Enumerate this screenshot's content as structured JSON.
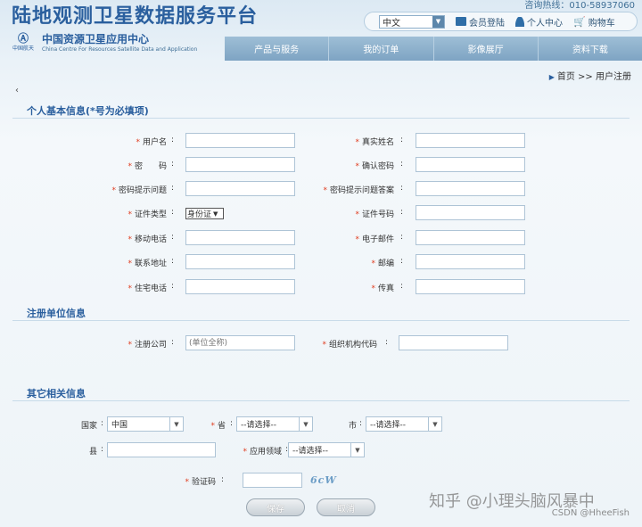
{
  "header": {
    "hotline": "咨询热线：010-58937060",
    "site_title": "陆地观测卫星数据服务平台",
    "org_logo_text": "中国航天",
    "org_name": "中国资源卫星应用中心",
    "org_name_en": "China Centre For Resources Satellite Data and Application",
    "language": "中文",
    "tools": {
      "login": "会员登陆",
      "user_center": "个人中心",
      "cart": "购物车"
    },
    "nav": [
      "产品与服务",
      "我的订单",
      "影像展厅",
      "资料下载"
    ]
  },
  "breadcrumb": {
    "home": "首页",
    "sep": ">>",
    "current": "用户注册"
  },
  "back_symbol": "‹",
  "sections": {
    "personal": "个人基本信息(*号为必填项)",
    "company": "注册单位信息",
    "other": "其它相关信息"
  },
  "personal_fields": {
    "username": "用户名",
    "realname": "真实姓名",
    "password": "密　　码",
    "confirm_password": "确认密码",
    "hint_question": "密码提示问题",
    "hint_answer": "密码提示问题答案",
    "id_type": "证件类型",
    "id_type_value": "身份证",
    "id_number": "证件号码",
    "mobile": "移动电话",
    "email": "电子邮件",
    "address": "联系地址",
    "postcode": "邮编",
    "home_phone": "住宅电话",
    "fax": "传真"
  },
  "company_fields": {
    "company": "注册公司",
    "company_placeholder": "(单位全称)",
    "org_code": "组织机构代码"
  },
  "other_fields": {
    "country": "国家",
    "country_value": "中国",
    "province": "省",
    "province_value": "--请选择--",
    "city": "市",
    "city_value": "--请选择--",
    "county": "县",
    "domain": "应用领域",
    "domain_value": "--请选择--",
    "captcha": "验证码",
    "captcha_image_text": "6cW"
  },
  "buttons": {
    "save": "保存",
    "cancel": "取消"
  },
  "watermark": {
    "zhihu": "知乎 @小理头脑风暴中",
    "csdn": "CSDN @HheeFish"
  }
}
